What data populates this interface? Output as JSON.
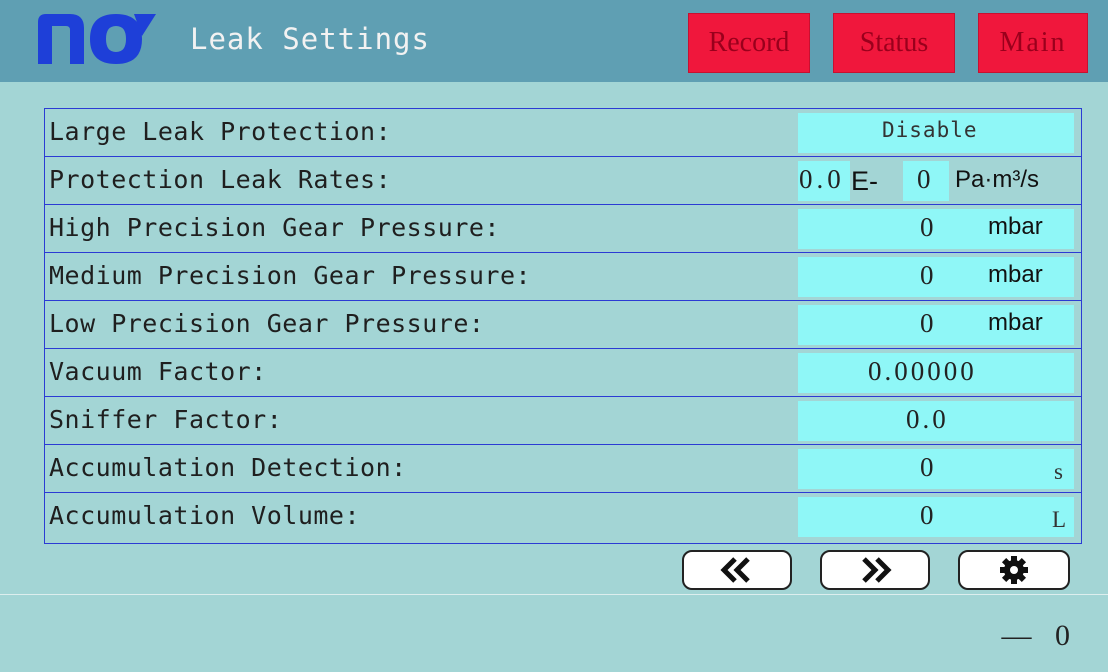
{
  "header": {
    "title": "Leak Settings",
    "buttons": {
      "record": "Record",
      "status": "Status",
      "main": "Main"
    },
    "accent_color": "#f0173c",
    "logo_color": "#1e3fd8"
  },
  "settings": {
    "large_leak_protection": {
      "label": "Large Leak Protection:",
      "value": "Disable"
    },
    "protection_leak_rates": {
      "label": "Protection Leak Rates:",
      "mantissa": "0.0",
      "e_sign": "E-",
      "exponent": "0",
      "unit": "Pa·m³/s"
    },
    "high_precision_gear_pressure": {
      "label": "High Precision Gear Pressure:",
      "value": "0",
      "unit": "mbar"
    },
    "medium_precision_gear_pressure": {
      "label": "Medium Precision Gear Pressure:",
      "value": "0",
      "unit": "mbar"
    },
    "low_precision_gear_pressure": {
      "label": "Low Precision Gear Pressure:",
      "value": "0",
      "unit": "mbar"
    },
    "vacuum_factor": {
      "label": "Vacuum Factor:",
      "value": "0.00000"
    },
    "sniffer_factor": {
      "label": "Sniffer Factor:",
      "value": "0.0"
    },
    "accumulation_detection": {
      "label": "Accumulation Detection:",
      "value": "0",
      "unit": "s"
    },
    "accumulation_volume": {
      "label": "Accumulation Volume:",
      "value": "0",
      "unit": "L"
    }
  },
  "nav": {
    "prev_icon": "double-chevron-left-icon",
    "next_icon": "double-chevron-right-icon",
    "settings_icon": "gear-icon"
  },
  "footer": {
    "value": "— 0"
  }
}
